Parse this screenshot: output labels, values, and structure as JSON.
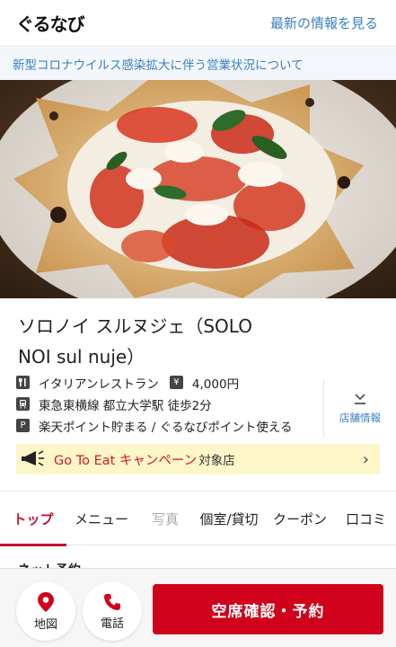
{
  "header": {
    "logo": "ぐるなび",
    "latest_link": "最新の情報を見る"
  },
  "notice": {
    "text": "新型コロナウイルス感染拡大に伴う営業状況について"
  },
  "restaurant": {
    "name_line1": "ソロノイ スルヌジェ（SOLO",
    "name_line2": "NOI sul nuje）",
    "genre": "イタリアンレストラン",
    "budget": "4,000円",
    "access": "東急東横線 都立大学駅 徒歩2分",
    "points": "楽天ポイント貯まる / ぐるなびポイント使える",
    "icons": {
      "genre": "fork-knife-icon",
      "budget": "yen-icon",
      "access": "train-icon",
      "points": "point-icon"
    }
  },
  "shop_info": {
    "label": "店舗情報"
  },
  "goto_eat": {
    "campaign": "Go To Eat キャンペーン",
    "suffix": "対象店"
  },
  "tabs": [
    {
      "label": "トップ"
    },
    {
      "label": "メニュー"
    },
    {
      "label": "写真"
    },
    {
      "label": "個室/貸切"
    },
    {
      "label": "クーポン"
    },
    {
      "label": "口コミ"
    }
  ],
  "section": {
    "net_reserve": "ネット予約"
  },
  "bottom_bar": {
    "map_label": "地図",
    "phone_label": "電話",
    "reserve_label": "空席確認・予約"
  },
  "colors": {
    "accent": "#d0021b",
    "link": "#3a7fc4",
    "campaign_bg": "#fdf6c8"
  }
}
